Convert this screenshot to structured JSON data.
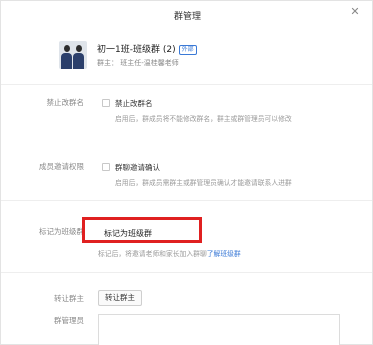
{
  "dialog": {
    "title": "群管理",
    "close_glyph": "✕"
  },
  "group": {
    "name": "初一1班-班级群 (2)",
    "tag": "外部",
    "owner": "群主：  班主任-温桂馨老师"
  },
  "rename": {
    "label": "禁止改群名",
    "option": "禁止改群名",
    "desc": "启用后，群成员将不能修改群名，群主或群管理员可以修改"
  },
  "invite": {
    "label": "成员邀请权限",
    "option": "群聊邀请确认",
    "desc": "启用后，群成员需群主或群管理员确认才能邀请联系人进群"
  },
  "mark": {
    "label": "标记为班级群",
    "button": "标记为班级群",
    "desc": "标记后，将邀请老师和家长加入群聊",
    "link": "了解班级群"
  },
  "transfer": {
    "label": "转让群主",
    "button": "转让群主"
  },
  "admins": {
    "label": "群管理员"
  },
  "icons": {
    "close": "close-icon",
    "avatar": "group-avatar-icon"
  },
  "colors": {
    "accent": "#3a79d6",
    "highlight": "#e02020"
  }
}
